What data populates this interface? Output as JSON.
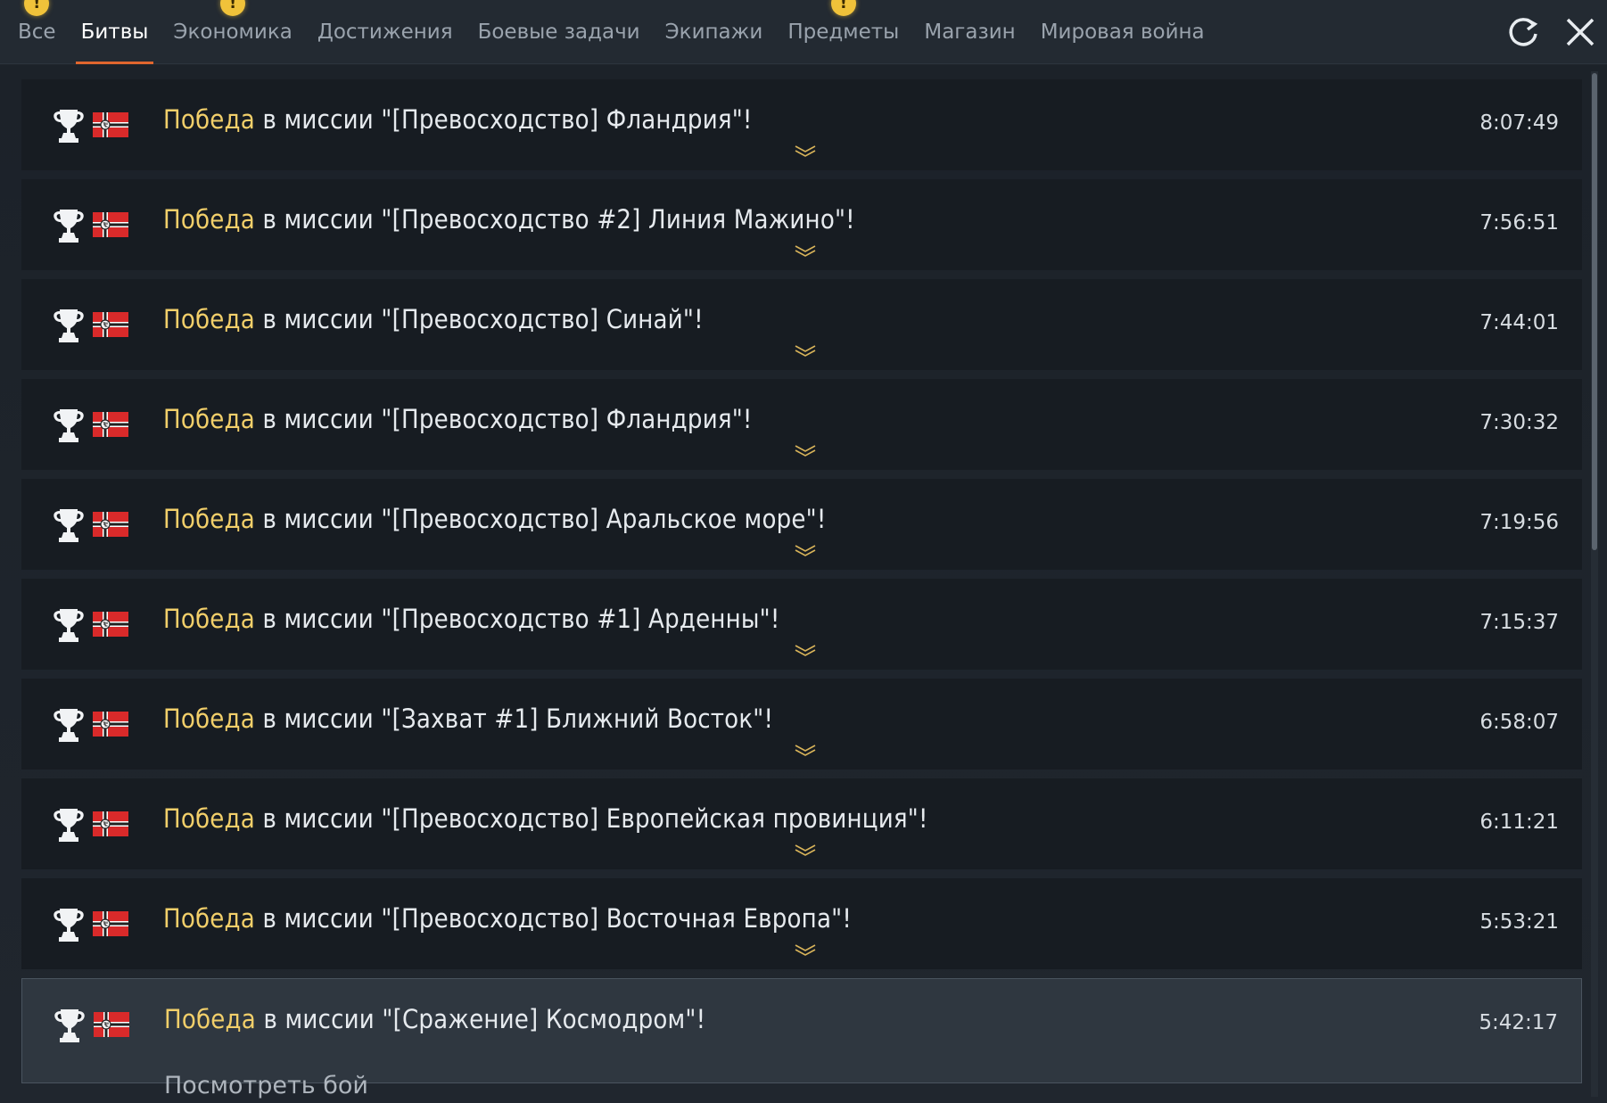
{
  "tabs": [
    {
      "label": "Все",
      "alert": true,
      "active": false
    },
    {
      "label": "Битвы",
      "alert": false,
      "active": true
    },
    {
      "label": "Экономика",
      "alert": true,
      "active": false
    },
    {
      "label": "Достижения",
      "alert": false,
      "active": false
    },
    {
      "label": "Боевые задачи",
      "alert": false,
      "active": false
    },
    {
      "label": "Экипажи",
      "alert": false,
      "active": false
    },
    {
      "label": "Предметы",
      "alert": true,
      "active": false
    },
    {
      "label": "Магазин",
      "alert": false,
      "active": false
    },
    {
      "label": "Мировая война",
      "alert": false,
      "active": false
    }
  ],
  "alert_glyph": "!",
  "toolbar": {
    "refresh_icon": "refresh-icon",
    "close_icon": "close-icon"
  },
  "colors": {
    "accent": "#e0662e",
    "victory": "#f2cf6a",
    "alert": "#f0c23a"
  },
  "entries": [
    {
      "result": "Победа",
      "text": " в миссии \"[Превосходство] Фландрия\"!",
      "time": "8:07:49"
    },
    {
      "result": "Победа",
      "text": " в миссии \"[Превосходство #2] Линия Мажино\"!",
      "time": "7:56:51"
    },
    {
      "result": "Победа",
      "text": " в миссии \"[Превосходство] Синай\"!",
      "time": "7:44:01"
    },
    {
      "result": "Победа",
      "text": " в миссии \"[Превосходство] Фландрия\"!",
      "time": "7:30:32"
    },
    {
      "result": "Победа",
      "text": " в миссии \"[Превосходство] Аральское море\"!",
      "time": "7:19:56"
    },
    {
      "result": "Победа",
      "text": " в миссии \"[Превосходство #1] Арденны\"!",
      "time": "7:15:37"
    },
    {
      "result": "Победа",
      "text": " в миссии \"[Захват #1] Ближний Восток\"!",
      "time": "6:58:07"
    },
    {
      "result": "Победа",
      "text": " в миссии \"[Превосходство] Европейская провинция\"!",
      "time": "6:11:21"
    },
    {
      "result": "Победа",
      "text": " в миссии \"[Превосходство] Восточная Европа\"!",
      "time": "5:53:21"
    },
    {
      "result": "Победа",
      "text": " в миссии \"[Сражение] Космодром\"!",
      "time": "5:42:17",
      "selected": true
    }
  ],
  "selected_action": "Посмотреть бой"
}
